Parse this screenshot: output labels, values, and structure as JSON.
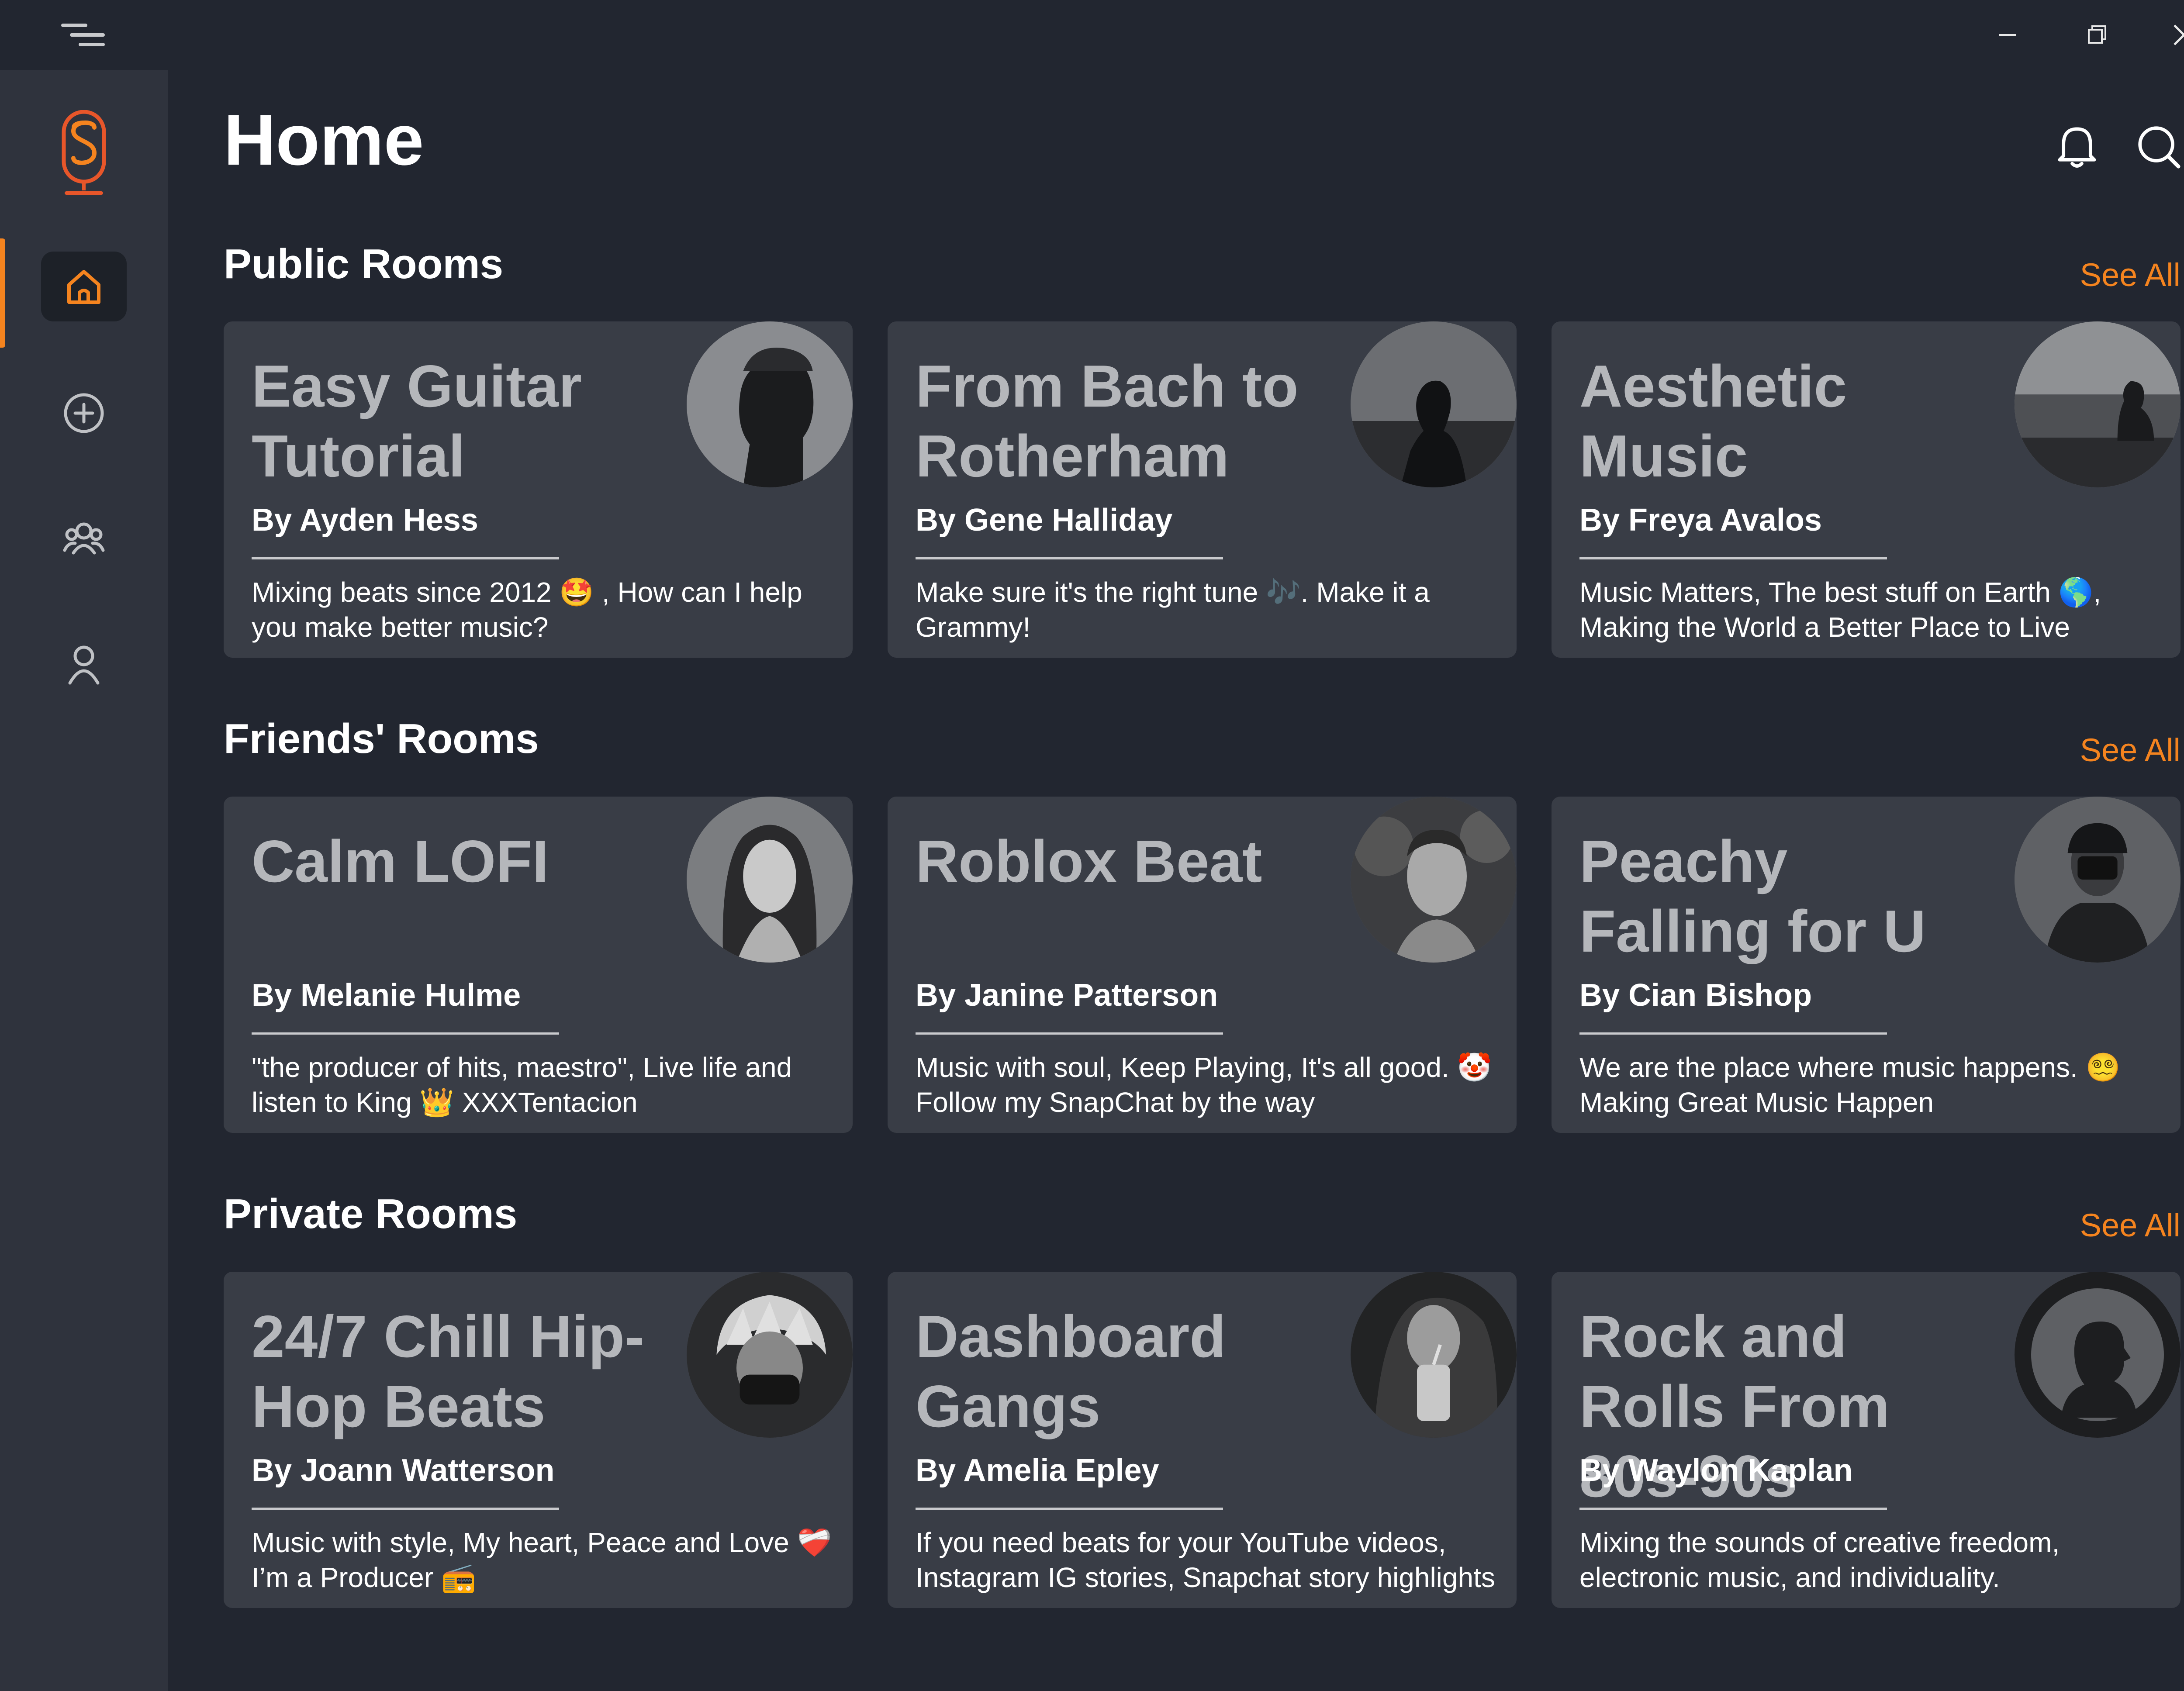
{
  "app": {
    "page_title": "Home",
    "accent_color": "#f5841f",
    "icons": {
      "menu": "hamburger-icon",
      "minimize": "minimize-icon",
      "restore": "restore-icon",
      "close": "close-icon",
      "notifications": "bell-icon",
      "search": "search-icon"
    }
  },
  "sidebar": {
    "items": [
      {
        "name": "home",
        "icon": "home-icon",
        "active": true
      },
      {
        "name": "create",
        "icon": "add-circle-icon",
        "active": false
      },
      {
        "name": "friends",
        "icon": "group-icon",
        "active": false
      },
      {
        "name": "profile",
        "icon": "user-icon",
        "active": false
      }
    ]
  },
  "sections": [
    {
      "title": "Public Rooms",
      "see_all": "See All",
      "cards": [
        {
          "title": "Easy Guitar Tutorial",
          "author": "By Ayden Hess",
          "desc": "Mixing beats since 2012 🤩 , How can I help you make better music?"
        },
        {
          "title": "From Bach to Rotherham",
          "author": "By Gene Halliday",
          "desc": "Make sure it's the right tune 🎶. Make it a Grammy!"
        },
        {
          "title": "Aesthetic Music",
          "author": "By Freya Avalos",
          "desc": "Music Matters, The best stuff on Earth 🌎, Making the World a Better Place to Live"
        }
      ]
    },
    {
      "title": "Friends' Rooms",
      "see_all": "See All",
      "cards": [
        {
          "title": "Calm LOFI",
          "author": "By Melanie Hulme",
          "desc": "\"the producer of hits, maestro\", Live life and listen to King 👑 XXXTentacion"
        },
        {
          "title": "Roblox Beat",
          "author": "By Janine Patterson",
          "desc": "Music with soul, Keep Playing, It's all good. 🤡 Follow my SnapChat by the way"
        },
        {
          "title": "Peachy Falling for U",
          "author": "By Cian Bishop",
          "desc": "We are the place where music happens.  😵‍💫 Making Great Music Happen"
        }
      ]
    },
    {
      "title": "Private Rooms",
      "see_all": "See All",
      "cards": [
        {
          "title": "24/7 Chill Hip-Hop Beats",
          "author": "By Joann Watterson",
          "desc": "Music with style, My heart, Peace and Love ❤️‍🩹 I’m a Producer 📻"
        },
        {
          "title": "Dashboard Gangs",
          "author": "By Amelia Epley",
          "desc": "If you need beats for your YouTube videos, Instagram IG stories, Snapchat story highlights"
        },
        {
          "title": "Rock and Rolls From 80s-90s",
          "author": "By Waylon Kaplan",
          "desc": "Mixing the sounds of creative freedom, electronic music, and individuality."
        }
      ]
    }
  ]
}
